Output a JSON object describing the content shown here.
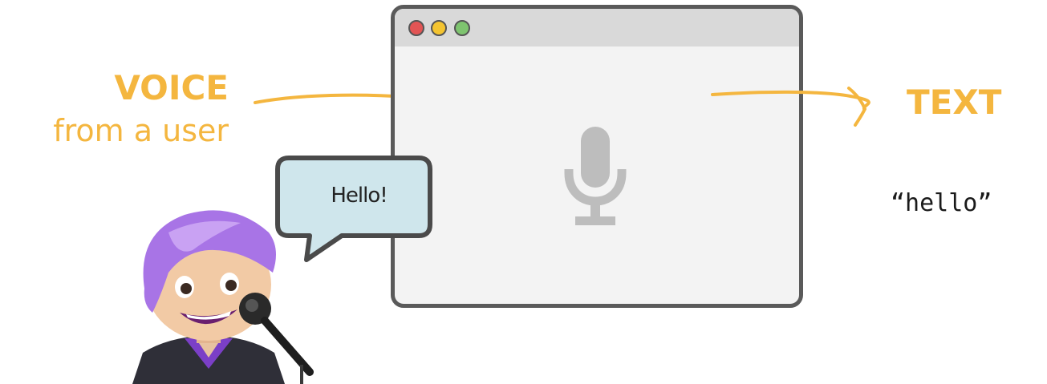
{
  "input": {
    "title": "VOICE",
    "subtitle": "from a user"
  },
  "output": {
    "title": "TEXT",
    "result": "“hello”"
  },
  "speech_bubble": {
    "text": "Hello!"
  },
  "window": {
    "controls": [
      "close",
      "minimize",
      "maximize"
    ],
    "center_icon": "microphone-icon"
  },
  "colors": {
    "accent": "#f4b63f",
    "window_border": "#5a5a5a",
    "window_bg": "#f3f3f3",
    "titlebar_bg": "#d9d9d9",
    "close": "#e25555",
    "minimize": "#f4c430",
    "maximize": "#7ec46f",
    "mic": "#bdbdbd",
    "bubble_bg": "#cfe6ec",
    "hair": "#a874e6"
  }
}
